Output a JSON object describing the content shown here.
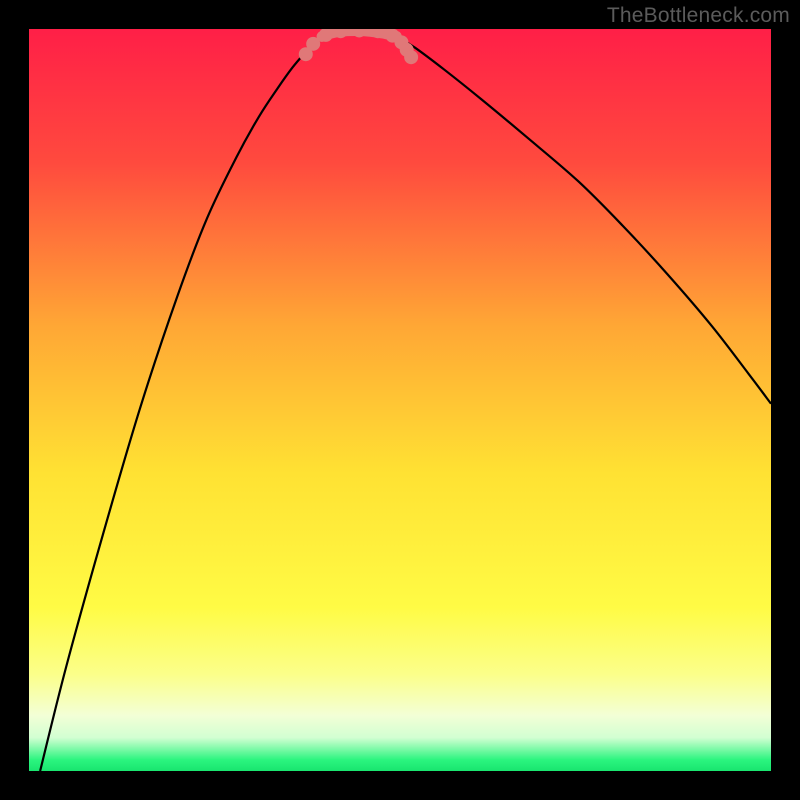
{
  "watermark": "TheBottleneck.com",
  "chart_data": {
    "type": "line",
    "title": "",
    "xlabel": "",
    "ylabel": "",
    "xlim": [
      0,
      1
    ],
    "ylim": [
      0,
      1
    ],
    "gradient_stops": [
      {
        "offset": 0.0,
        "color": "#ff1f47"
      },
      {
        "offset": 0.18,
        "color": "#ff4a3e"
      },
      {
        "offset": 0.4,
        "color": "#ffa735"
      },
      {
        "offset": 0.6,
        "color": "#ffe233"
      },
      {
        "offset": 0.78,
        "color": "#fffb45"
      },
      {
        "offset": 0.87,
        "color": "#fbff8a"
      },
      {
        "offset": 0.925,
        "color": "#f3ffd6"
      },
      {
        "offset": 0.955,
        "color": "#d2ffd2"
      },
      {
        "offset": 0.985,
        "color": "#2bf57f"
      },
      {
        "offset": 1.0,
        "color": "#19e56f"
      }
    ],
    "series": [
      {
        "name": "left-branch",
        "color": "#000000",
        "width": 2.2,
        "x": [
          0.015,
          0.05,
          0.1,
          0.15,
          0.2,
          0.24,
          0.28,
          0.31,
          0.335,
          0.355,
          0.372,
          0.385,
          0.395
        ],
        "y": [
          0.0,
          0.14,
          0.32,
          0.49,
          0.64,
          0.745,
          0.828,
          0.882,
          0.92,
          0.948,
          0.968,
          0.982,
          0.99
        ]
      },
      {
        "name": "right-branch",
        "color": "#000000",
        "width": 2.2,
        "x": [
          0.495,
          0.52,
          0.56,
          0.61,
          0.67,
          0.74,
          0.8,
          0.86,
          0.92,
          0.97,
          1.0
        ],
        "y": [
          0.99,
          0.975,
          0.945,
          0.905,
          0.855,
          0.795,
          0.735,
          0.67,
          0.6,
          0.535,
          0.495
        ]
      },
      {
        "name": "valley-marker",
        "color": "#e07878",
        "width": 11,
        "linecap": "round",
        "x": [
          0.395,
          0.405,
          0.42,
          0.44,
          0.46,
          0.48,
          0.495
        ],
        "y": [
          0.99,
          0.994,
          0.997,
          0.998,
          0.997,
          0.994,
          0.99
        ]
      }
    ],
    "dots": {
      "name": "valley-dots",
      "color": "#e07878",
      "radius": 7,
      "points": [
        {
          "x": 0.373,
          "y": 0.966
        },
        {
          "x": 0.383,
          "y": 0.98
        },
        {
          "x": 0.4,
          "y": 0.992
        },
        {
          "x": 0.42,
          "y": 0.997
        },
        {
          "x": 0.445,
          "y": 0.998
        },
        {
          "x": 0.47,
          "y": 0.997
        },
        {
          "x": 0.49,
          "y": 0.991
        },
        {
          "x": 0.502,
          "y": 0.982
        },
        {
          "x": 0.509,
          "y": 0.972
        },
        {
          "x": 0.515,
          "y": 0.962
        }
      ]
    }
  }
}
